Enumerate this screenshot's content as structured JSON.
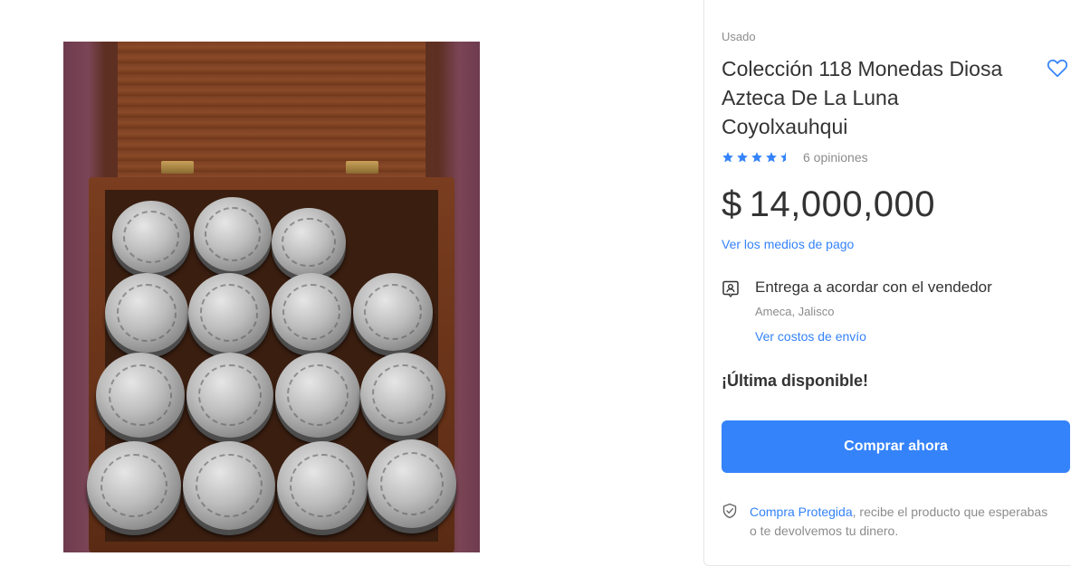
{
  "product": {
    "condition": "Usado",
    "title": "Colección 118 Monedas Diosa Azteca De La Luna Coyolxauhqui",
    "rating": 4.5,
    "reviews_label": "6 opiniones",
    "currency_symbol": "$",
    "price": "14,000,000",
    "payment_link": "Ver los medios de pago",
    "delivery": {
      "text": "Entrega a acordar con el vendedor",
      "location": "Ameca, Jalisco",
      "shipping_link": "Ver costos de envío"
    },
    "stock_label": "¡Última disponible!",
    "buy_button_label": "Comprar ahora",
    "protected": {
      "link": "Compra Protegida",
      "text": ", recibe el producto que esperabas o te devolvemos tu dinero."
    }
  },
  "icons": {
    "favorite": "heart-icon",
    "star": "star-icon",
    "delivery": "delivery-agreement-icon",
    "protected": "shield-check-icon"
  },
  "colors": {
    "accent": "#3483fa",
    "star": "#3483fa",
    "text": "#333333",
    "muted": "#8c8c8c"
  }
}
